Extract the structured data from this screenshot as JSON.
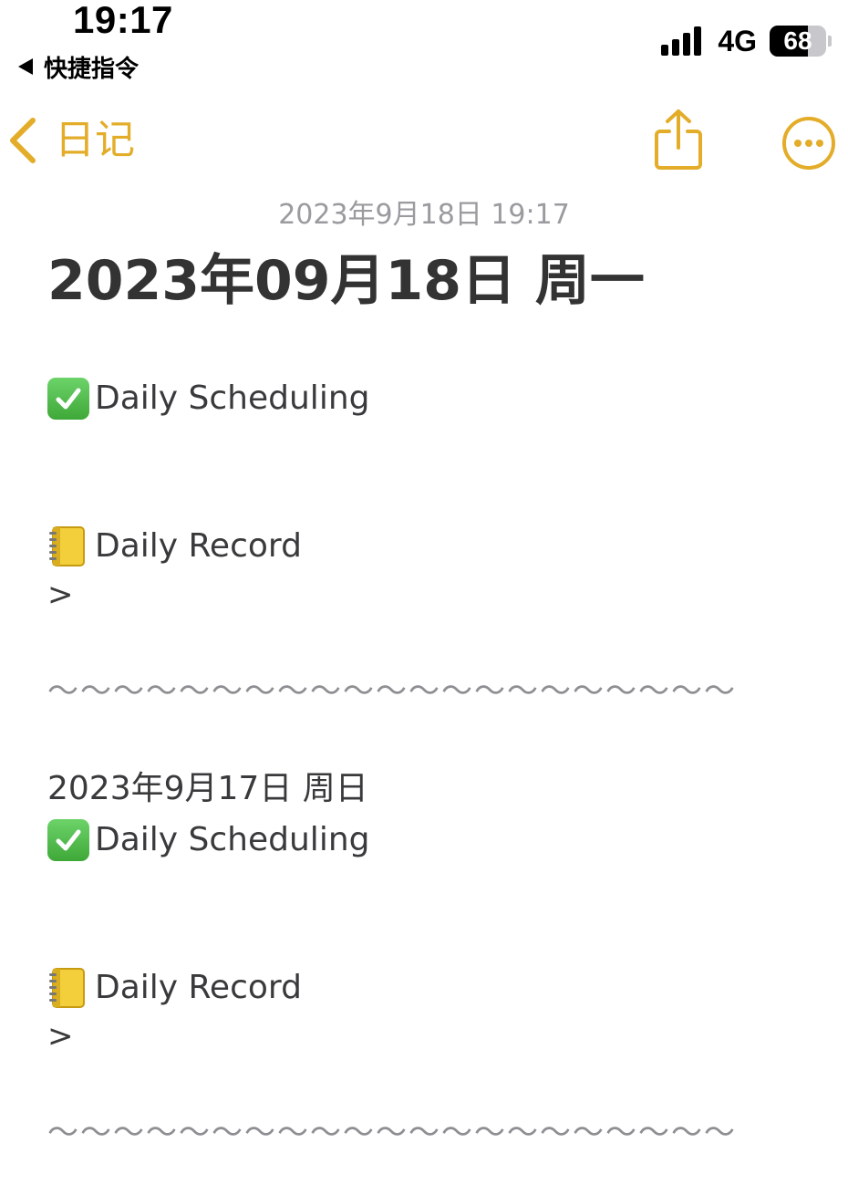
{
  "status_bar": {
    "time": "19:17",
    "back_app": "快捷指令",
    "network": "4G",
    "battery": 68,
    "battery_fraction": 0.68
  },
  "nav": {
    "back_label": "日记",
    "accent_color": "#e3ad2a",
    "icons": [
      "chevron-left-icon",
      "share-icon",
      "more-icon"
    ]
  },
  "note": {
    "timestamp": "2023年9月18日 19:17",
    "title": "2023年09月18日 周一",
    "entries": [
      {
        "date": "",
        "scheduling": "Daily Scheduling",
        "record": "Daily Record",
        "quote": ">",
        "separator": "～～～～～～～～～～～～～～～～～～～～～"
      },
      {
        "date": "2023年9月17日 周日",
        "scheduling": "Daily Scheduling",
        "record": "Daily Record",
        "quote": ">",
        "separator": "～～～～～～～～～～～～～～～～～～～～～"
      }
    ]
  }
}
